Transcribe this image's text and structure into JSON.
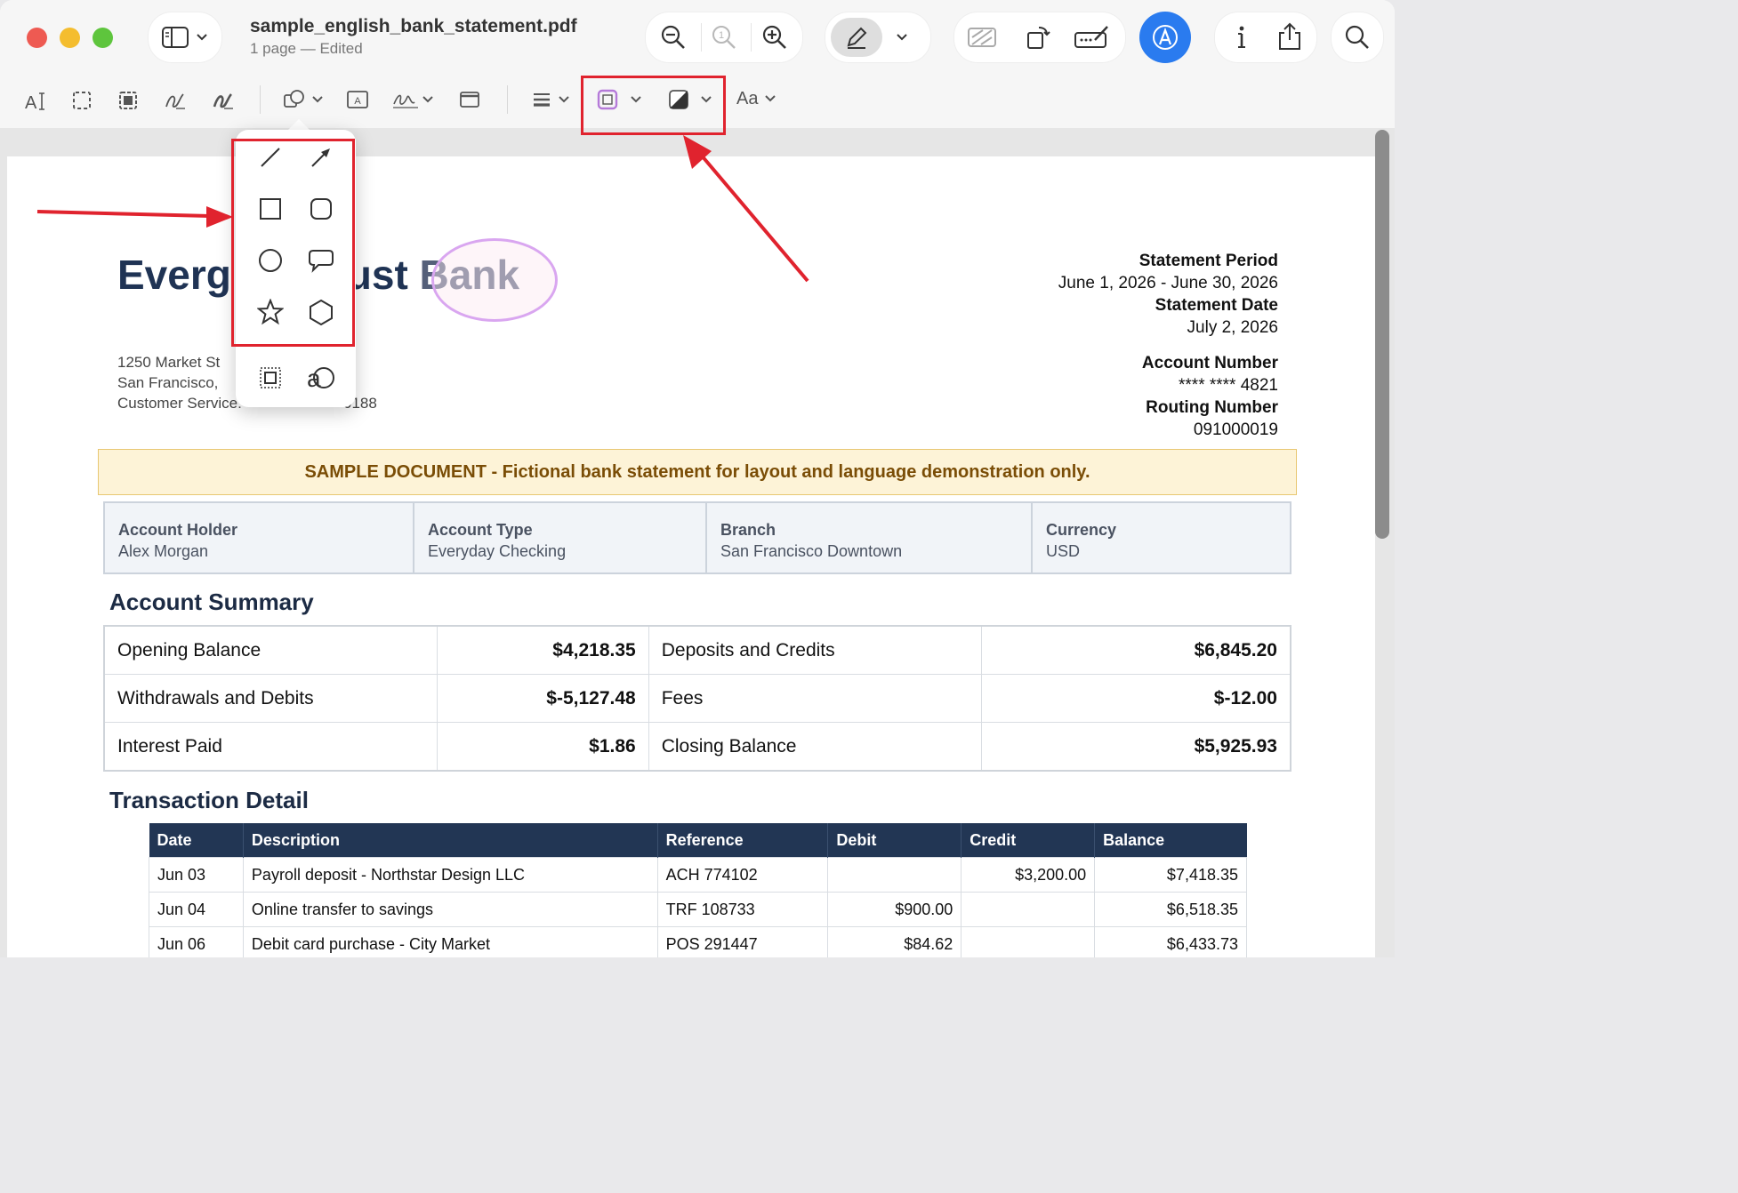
{
  "window": {
    "filename": "sample_english_bank_statement.pdf",
    "subtitle": "1 page — Edited"
  },
  "colors": {
    "accent": "#2a7bef",
    "annotation_red": "#e0232e",
    "bank_navy": "#1f3354",
    "banner_bg": "#fdf3d7",
    "banner_text": "#7a4d06",
    "ellipse_stroke": "#d9a6f0"
  },
  "toolbar": {
    "top_icons": [
      "sidebar-icon",
      "zoom-out-icon",
      "actual-size-icon",
      "zoom-in-icon",
      "markup-pen-icon",
      "redact-icon",
      "rotate-icon",
      "form-fill-icon",
      "markup-toolbar-icon",
      "info-icon",
      "share-icon",
      "search-icon"
    ],
    "markup_icons": [
      "text-selection-icon",
      "rectangular-selection-icon",
      "smart-lasso-icon",
      "sketch-icon",
      "draw-icon",
      "shapes-icon",
      "text-box-icon",
      "sign-icon",
      "note-icon",
      "shape-style-icon",
      "border-color-icon",
      "fill-color-icon"
    ],
    "text_style_label": "Aa"
  },
  "shapes_popover": {
    "shapes": [
      "line-shape-icon",
      "arrow-shape-icon",
      "rectangle-shape-icon",
      "rounded-rectangle-shape-icon",
      "oval-shape-icon",
      "speech-bubble-shape-icon",
      "star-shape-icon",
      "hexagon-shape-icon"
    ],
    "extras": [
      "mask-border-icon",
      "loupe-icon"
    ]
  },
  "statement": {
    "bank_name_visible": [
      "Everg",
      "rust",
      "Bank"
    ],
    "address_line1": "1250 Market St",
    "address_line2": "San Francisco,",
    "address_line3": "Customer Service:",
    "phone_tail": "0188",
    "period_label": "Statement Period",
    "period_value": "June 1, 2026 - June 30, 2026",
    "date_label": "Statement Date",
    "date_value": "July 2, 2026",
    "account_label": "Account Number",
    "account_value": "**** **** 4821",
    "routing_label": "Routing Number",
    "routing_value": "091000019",
    "banner": "SAMPLE DOCUMENT - Fictional bank statement for layout and language demonstration only.",
    "info": [
      {
        "label": "Account Holder",
        "value": "Alex Morgan"
      },
      {
        "label": "Account Type",
        "value": "Everyday Checking"
      },
      {
        "label": "Branch",
        "value": "San Francisco Downtown"
      },
      {
        "label": "Currency",
        "value": "USD"
      }
    ],
    "summary_heading": "Account Summary",
    "summary": [
      [
        "Opening Balance",
        "$4,218.35",
        "Deposits and Credits",
        "$6,845.20"
      ],
      [
        "Withdrawals and Debits",
        "$-5,127.48",
        "Fees",
        "$-12.00"
      ],
      [
        "Interest Paid",
        "$1.86",
        "Closing Balance",
        "$5,925.93"
      ]
    ],
    "transactions_heading": "Transaction Detail",
    "tx_headers": [
      "Date",
      "Description",
      "Reference",
      "Debit",
      "Credit",
      "Balance"
    ],
    "transactions": [
      [
        "Jun 03",
        "Payroll deposit - Northstar Design LLC",
        "ACH 774102",
        "",
        "$3,200.00",
        "$7,418.35"
      ],
      [
        "Jun 04",
        "Online transfer to savings",
        "TRF 108733",
        "$900.00",
        "",
        "$6,518.35"
      ],
      [
        "Jun 06",
        "Debit card purchase - City Market",
        "POS 291447",
        "$84.62",
        "",
        "$6,433.73"
      ]
    ]
  }
}
